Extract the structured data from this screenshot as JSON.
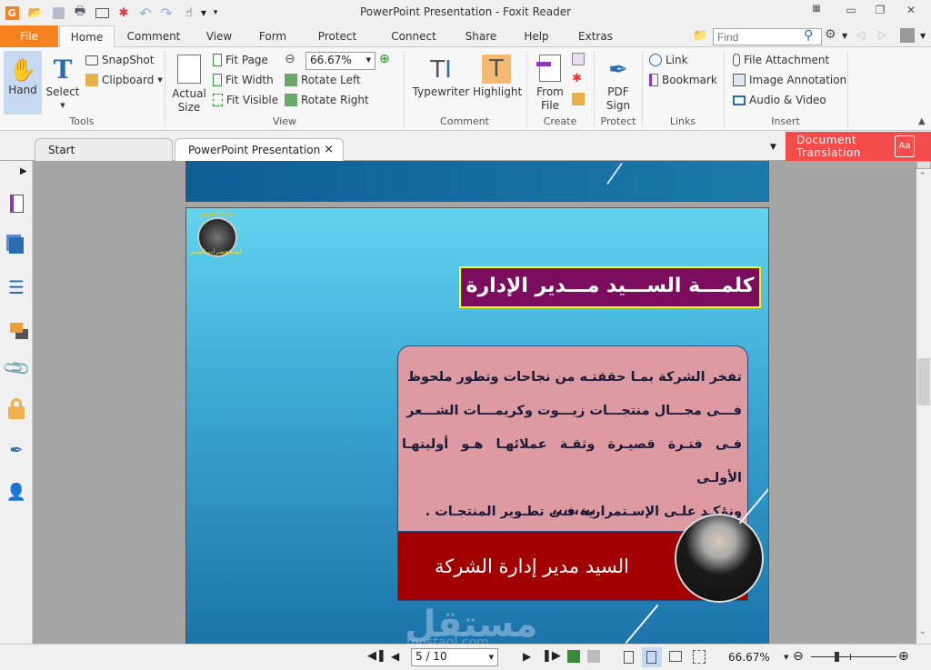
{
  "window": {
    "title": "PowerPoint Presentation - Foxit Reader"
  },
  "quick_access": [
    "foxit-logo-icon",
    "open-icon",
    "save-icon",
    "print-icon",
    "email-icon",
    "new-icon",
    "undo-icon",
    "redo-icon",
    "hand-tool-icon",
    "customize-icon"
  ],
  "menu_tabs": [
    {
      "label": "File"
    },
    {
      "label": "Home"
    },
    {
      "label": "Comment"
    },
    {
      "label": "View"
    },
    {
      "label": "Form"
    },
    {
      "label": "Protect"
    },
    {
      "label": "Connect"
    },
    {
      "label": "Share"
    },
    {
      "label": "Help"
    },
    {
      "label": "Extras"
    }
  ],
  "search": {
    "placeholder": "Find"
  },
  "ribbon": {
    "tools": {
      "label": "Tools",
      "hand": "Hand",
      "select": "Select",
      "snapshot": "SnapShot",
      "clipboard": "Clipboard"
    },
    "view": {
      "label": "View",
      "actual_size_1": "Actual",
      "actual_size_2": "Size",
      "fit_page": "Fit Page",
      "fit_width": "Fit Width",
      "fit_visible": "Fit Visible",
      "zoom_value": "66.67%",
      "rotate_left": "Rotate Left",
      "rotate_right": "Rotate Right"
    },
    "comment": {
      "label": "Comment",
      "typewriter": "Typewriter",
      "highlight": "Highlight"
    },
    "create": {
      "label": "Create",
      "from_file_1": "From",
      "from_file_2": "File"
    },
    "protect": {
      "label": "Protect",
      "pdf_sign_1": "PDF",
      "pdf_sign_2": "Sign"
    },
    "links": {
      "label": "Links",
      "link": "Link",
      "bookmark": "Bookmark"
    },
    "insert": {
      "label": "Insert",
      "file_attachment": "File Attachment",
      "image_annotation": "Image Annotation",
      "audio_video": "Audio & Video"
    }
  },
  "doc_tabs": [
    {
      "label": "Start"
    },
    {
      "label": "PowerPoint Presentation",
      "close": "×"
    }
  ],
  "doc_translation": {
    "line1": "Document",
    "line2": "Translation"
  },
  "slide": {
    "logo_text_top": "شركة الزيتون",
    "logo_text_bottom": "لمستحضرات الشعر",
    "title": "كلمـــة الســـيد مـــدير الإدارة",
    "body_lines": [
      "تفخر الشركة بمـا حققتـه من نجاحات وتطور ملحوظ",
      "فـــى مجـــال منتجـــات زيـــوت وكريمـــات الشـــعر",
      "فـى فتـرة قصيـرة وثقـة عملائهـا هـو أوليتهـا الأولـى",
      "ونؤكـد علـى الإسـتمرارية فـى تطـوير المنتجـات ."
    ],
    "quote_marks": "،،،،،،،،",
    "footer": "السيد مدير إدارة الشركة",
    "watermark_ar": "مستقل",
    "watermark_en": "mostaql.com"
  },
  "colors": {
    "file_tab": "#f5821f",
    "doc_translation": "#f44b4b",
    "slide_title_bg": "#7b0c5e",
    "slide_title_border": "#ffff00",
    "body_box": "#dd9ba1",
    "footer_bg": "#a20000"
  },
  "status": {
    "page_value": "5 / 10",
    "zoom": "66.67%"
  }
}
